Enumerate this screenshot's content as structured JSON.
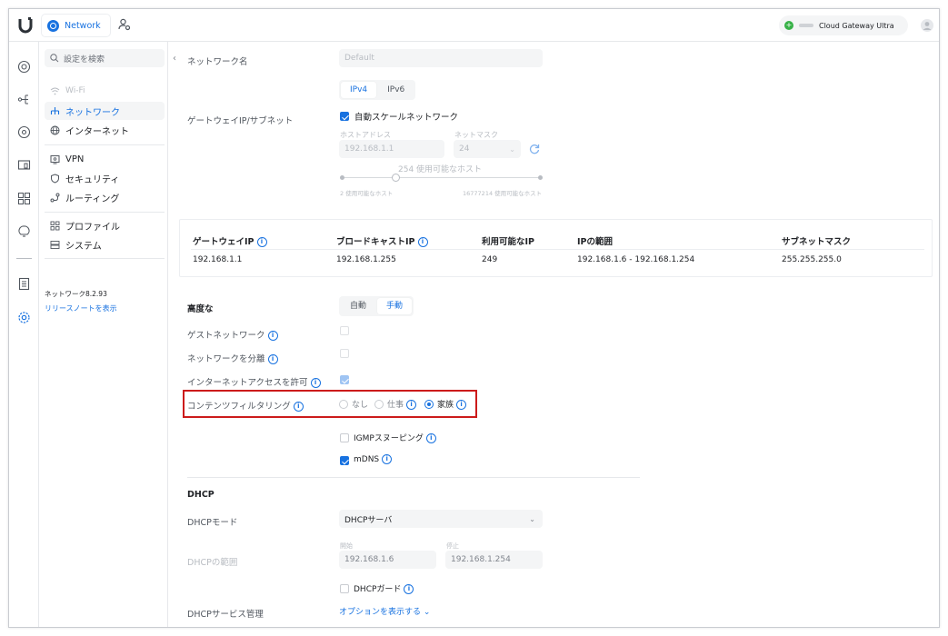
{
  "topbar": {
    "app_name": "Network",
    "gateway_name": "Cloud Gateway Ultra"
  },
  "sidebar": {
    "search_placeholder": "設定を検索",
    "items": [
      {
        "label": "Wi-Fi"
      },
      {
        "label": "ネットワーク"
      },
      {
        "label": "インターネット"
      },
      {
        "label": "VPN"
      },
      {
        "label": "セキュリティ"
      },
      {
        "label": "ルーティング"
      },
      {
        "label": "プロファイル"
      },
      {
        "label": "システム"
      }
    ],
    "version": "ネットワーク8.2.93",
    "release_notes": "リリースノートを表示"
  },
  "form": {
    "network_name_label": "ネットワーク名",
    "network_name_value": "Default",
    "ip_version_tabs": [
      "IPv4",
      "IPv6"
    ],
    "gateway_label": "ゲートウェイIP/サブネット",
    "auto_scale_label": "自動スケールネットワーク",
    "host_address_label": "ホストアドレス",
    "host_address_value": "192.168.1.1",
    "netmask_label": "ネットマスク",
    "netmask_value": "24",
    "usable_hosts_text": "254 使用可能なホスト",
    "slider_min_label": "2 使用可能なホスト",
    "slider_max_label": "16777214 使用可能なホスト",
    "slider_level": 0.27
  },
  "summary_table": {
    "headers": [
      "ゲートウェイIP",
      "ブロードキャストIP",
      "利用可能なIP",
      "IPの範囲",
      "サブネットマスク"
    ],
    "values": [
      "192.168.1.1",
      "192.168.1.255",
      "249",
      "192.168.1.6 - 192.168.1.254",
      "255.255.255.0"
    ]
  },
  "advanced": {
    "label": "高度な",
    "mode_tabs": [
      "自動",
      "手動"
    ],
    "guest_network_label": "ゲストネットワーク",
    "isolate_network_label": "ネットワークを分離",
    "internet_access_label": "インターネットアクセスを許可",
    "content_filtering_label": "コンテンツフィルタリング",
    "filter_options": [
      "なし",
      "仕事",
      "家族"
    ],
    "igmp_label": "IGMPスヌーピング",
    "mdns_label": "mDNS"
  },
  "dhcp": {
    "section_title": "DHCP",
    "mode_label": "DHCPモード",
    "mode_value": "DHCPサーバ",
    "range_label": "DHCPの範囲",
    "start_label": "開始",
    "start_value": "192.168.1.6",
    "stop_label": "停止",
    "stop_value": "192.168.1.254",
    "guard_label": "DHCPガード",
    "service_label": "DHCPサービス管理",
    "show_options": "オプションを表示する"
  }
}
